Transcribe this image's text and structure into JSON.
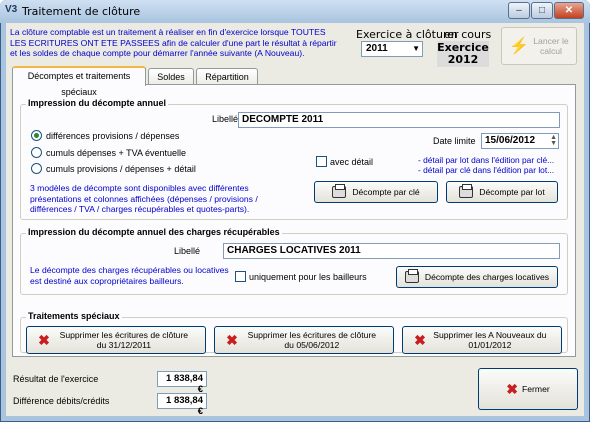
{
  "window": {
    "title": "Traitement de clôture",
    "app_icon": "V3"
  },
  "titlebar_buttons": {
    "minimize": "–",
    "maximize": "□",
    "close": "✕"
  },
  "intro": {
    "text": "La clôture comptable est un traitement à réaliser en fin d'exercice lorsque TOUTES LES ECRITURES ONT ETE PASSEES afin de calculer d'une part le résultat à répartir et les soldes de chaque compte pour démarrer l'année suivante (A Nouveau)."
  },
  "exercise": {
    "label": "Exercice à clôturer",
    "value": "2011"
  },
  "current": {
    "label": "en cours",
    "value": "Exercice\n2012"
  },
  "launch": {
    "label": "Lancer le\ncalcul"
  },
  "tabs": [
    {
      "label": "Décomptes et traitements spéciaux"
    },
    {
      "label": "Soldes"
    },
    {
      "label": "Répartition"
    }
  ],
  "annual": {
    "title": "Impression du décompte annuel",
    "libelle_label": "Libellé",
    "libelle_value": "DECOMPTE 2011",
    "options": [
      {
        "label": "différences provisions / dépenses",
        "selected": true
      },
      {
        "label": "cumuls dépenses + TVA éventuelle",
        "selected": false
      },
      {
        "label": "cumuls provisions / dépenses + détail",
        "selected": false
      }
    ],
    "date_label": "Date limite",
    "date_value": "15/06/2012",
    "detail_label": "avec détail",
    "detail_note_1": "- détail par lot dans l'édition par clé...",
    "detail_note_2": "- détail par clé dans l'édition par lot...",
    "info": "3 modèles de décompte sont disponibles avec différentes présentations et colonnes affichées (dépenses / provisions / différences / TVA / charges récupérables et quotes-parts).",
    "btn_by_key": "Décompte par clé",
    "btn_by_lot": "Décompte par lot"
  },
  "charges": {
    "title": "Impression du décompte annuel des charges récupérables",
    "libelle_label": "Libellé",
    "libelle_value": "CHARGES LOCATIVES 2011",
    "info": "Le décompte des charges récupérables ou locatives est destiné aux copropriétaires bailleurs.",
    "check_label": "uniquement pour les bailleurs",
    "btn": "Décompte des charges locatives"
  },
  "special": {
    "title": "Traitements spéciaux",
    "btn_1": "Supprimer les écritures de clôture du 31/12/2011",
    "btn_2": "Supprimer les écritures de clôture du 05/06/2012",
    "btn_3": "Supprimer les A Nouveaux du 01/01/2012"
  },
  "footer": {
    "result_label": "Résultat de l'exercice",
    "result_value": "1 838,84 €",
    "diff_label": "Différence débits/crédits",
    "diff_value": "1 838,84 €",
    "close_btn": "Fermer"
  }
}
